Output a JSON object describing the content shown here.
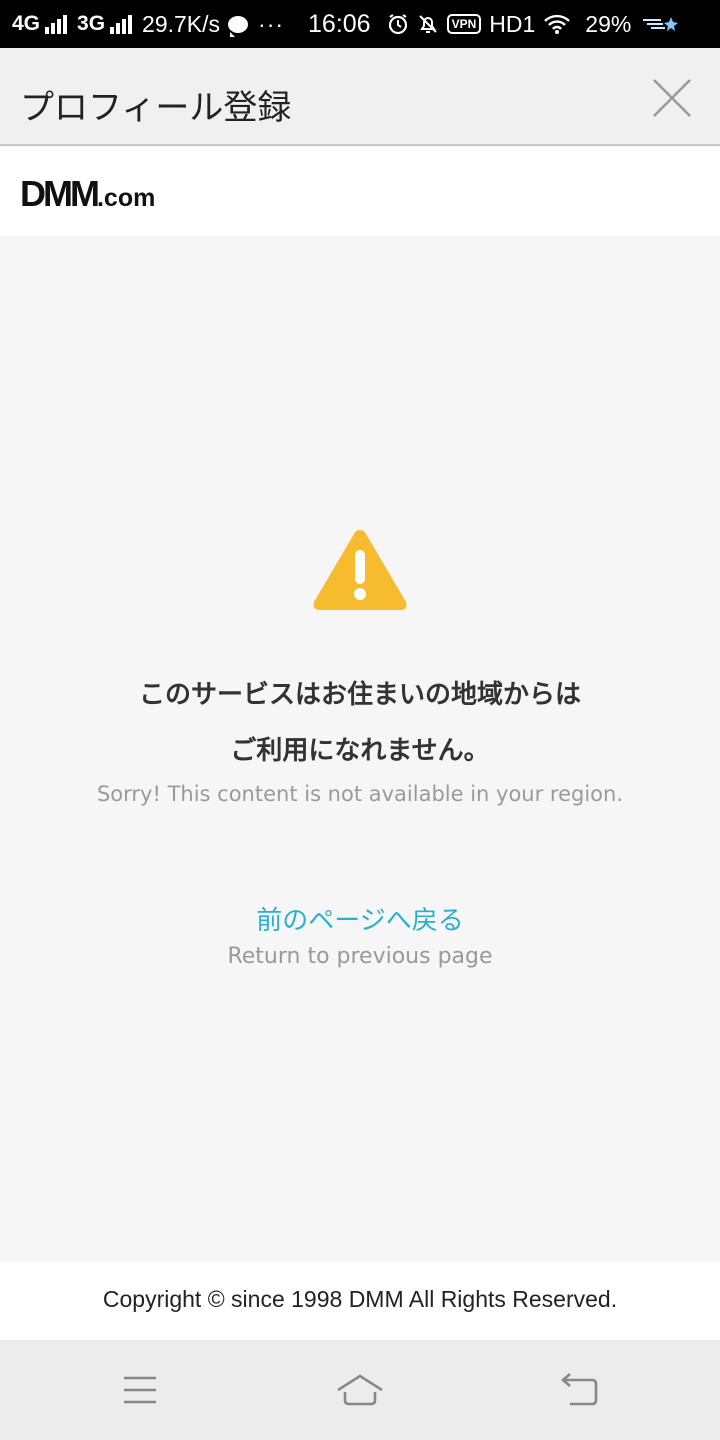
{
  "status_bar": {
    "network_1": "4G",
    "network_2": "3G",
    "speed": "29.7K/s",
    "more": "···",
    "time": "16:06",
    "vpn": "VPN",
    "hd": "HD1",
    "battery": "29%"
  },
  "header": {
    "title": "プロフィール登録"
  },
  "brand": {
    "logo_main": "DMM",
    "logo_tld": ".com"
  },
  "message": {
    "line1_ja": "このサービスはお住まいの地域からは",
    "line2_ja": "ご利用になれません。",
    "en": "Sorry! This content is not available in your region.",
    "back_ja": "前のページへ戻る",
    "back_en": "Return to previous page"
  },
  "footer": {
    "copyright": "Copyright © since 1998 DMM All Rights Reserved."
  },
  "colors": {
    "warning": "#f6bb2f",
    "link": "#2ab0d0"
  }
}
